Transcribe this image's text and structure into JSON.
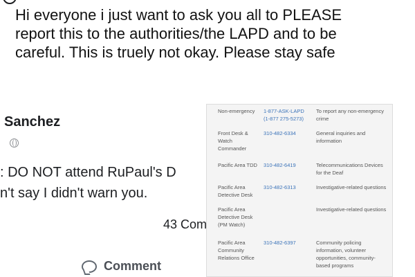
{
  "post": {
    "text": "Hi everyone i just want to ask you all to PLEASE report this to the authorities/the LAPD and to be careful. This is truely not okay. Please stay safe"
  },
  "fb_post": {
    "author": "Sanchez",
    "line1": ": DO NOT attend RuPaul's D",
    "line2": "n't say I didn't warn you.",
    "comment_count": "43 Com",
    "comment_label": "Comment"
  },
  "directory": {
    "rows": [
      {
        "label": "Non-emergency",
        "phone": "1-877-ASK-LAPD (1-877 275-5273)",
        "desc": "To report any non-emergency crime"
      },
      {
        "label": "Front Desk & Watch Commander",
        "phone": "310-482-6334",
        "desc": "General inquiries and information"
      },
      {
        "label": "Pacific Area TDD",
        "phone": "310-482-6419",
        "desc": "Telecommunications Devices for the Deaf"
      },
      {
        "label": "Pacific Area Detective Desk",
        "phone": "310-482-6313",
        "desc": "Investigative-related questions"
      },
      {
        "label": "Pacific Area Detective Desk (PM Watch)",
        "phone": "",
        "desc": "Investigative-related questions"
      },
      {
        "label": "Pacific Area Community Relations Office",
        "phone": "310-482-6397",
        "desc": "Community policing information, volunteer opportunities, community-based programs"
      }
    ]
  }
}
